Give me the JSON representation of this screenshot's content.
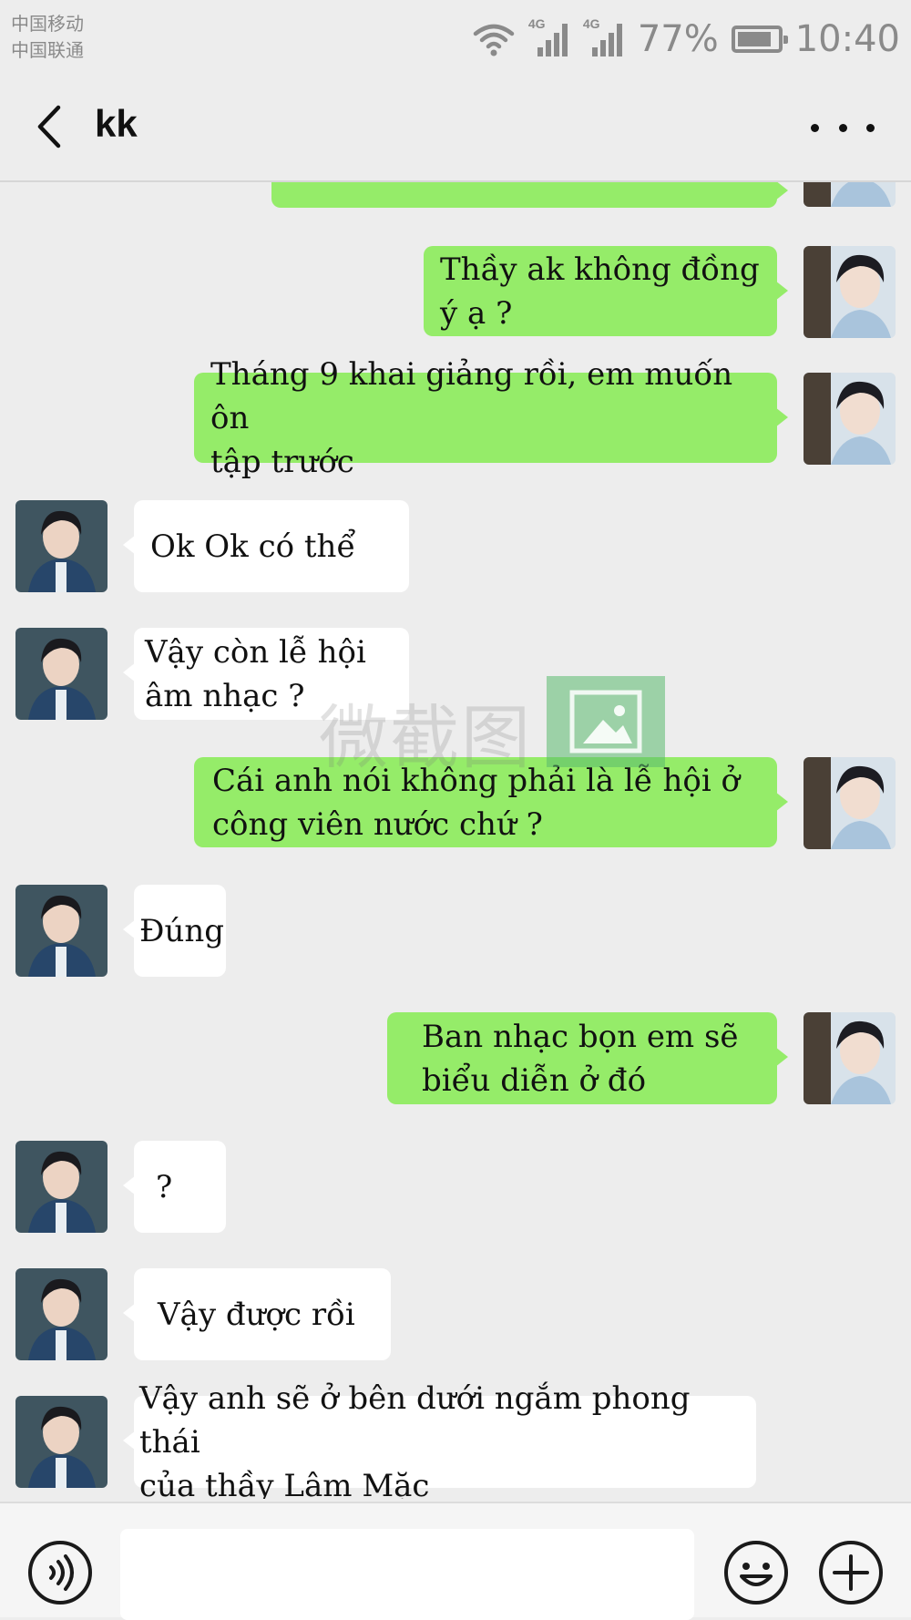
{
  "status_bar": {
    "carrier_1": "中国移动",
    "carrier_2": "中国联通",
    "network_1": "4G",
    "network_2": "4G",
    "battery": "77%",
    "time": "10:40"
  },
  "header": {
    "title": "kk"
  },
  "colors": {
    "my_bubble": "#95ec69",
    "their_bubble": "#ffffff",
    "background": "#ededed"
  },
  "messages": [
    {
      "side": "me",
      "text": ""
    },
    {
      "side": "me",
      "line1": "Thầy ak không đồng",
      "line2": "ý ạ ?"
    },
    {
      "side": "me",
      "line1": "Tháng 9 khai giảng rồi, em muốn ôn",
      "line2": "tập trước"
    },
    {
      "side": "them",
      "text": "Ok Ok có thể"
    },
    {
      "side": "them",
      "line1": "Vậy còn lễ hội",
      "line2": "âm nhạc ?"
    },
    {
      "side": "me",
      "line1": "Cái anh nói không phải là lễ hội ở",
      "line2": "công viên nước chứ ?"
    },
    {
      "side": "them",
      "text": "Đúng"
    },
    {
      "side": "me",
      "line1": "Ban nhạc bọn em sẽ",
      "line2": "biểu diễn ở đó"
    },
    {
      "side": "them",
      "text": "?"
    },
    {
      "side": "them",
      "text": "Vậy được rồi"
    },
    {
      "side": "them",
      "line1": "Vậy anh sẽ ở bên dưới ngắm phong thái",
      "line2": "của thầy Lâm Mặc"
    }
  ],
  "watermark": {
    "text": "微截图"
  },
  "input_bar": {
    "message_value": ""
  }
}
